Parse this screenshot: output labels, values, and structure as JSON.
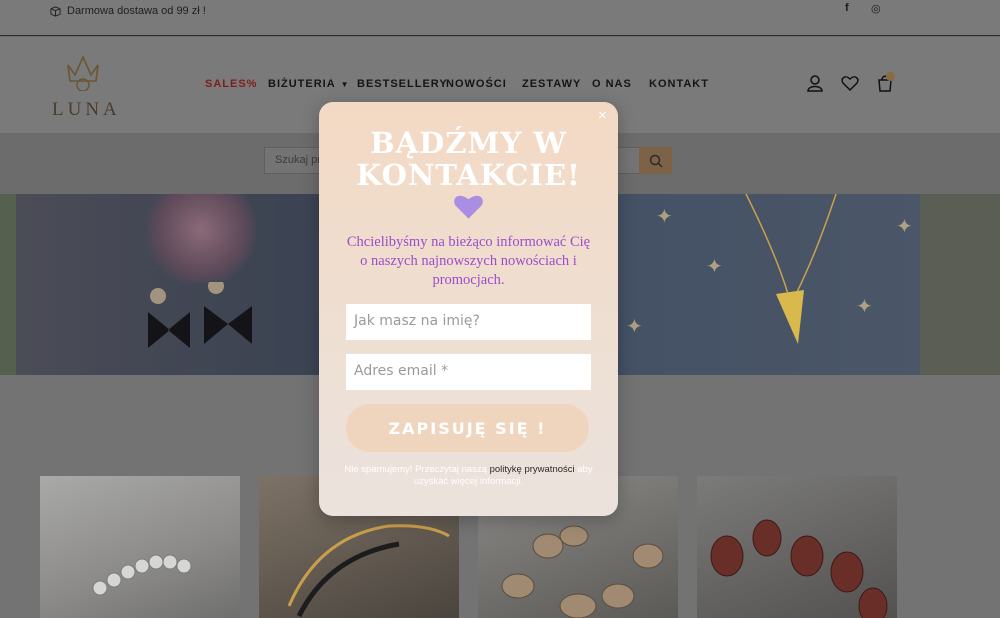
{
  "topbar": {
    "shipping_text": "Darmowa dostawa od 99 zł !",
    "facebook_glyph": "f",
    "instagram_glyph": "◎"
  },
  "header": {
    "logo_text": "LUNA",
    "nav": [
      {
        "label": "SALES%"
      },
      {
        "label": "BIŻUTERIA"
      },
      {
        "label": "BESTSELLERY"
      },
      {
        "label": "NOWOŚCI"
      },
      {
        "label": "ZESTAWY"
      },
      {
        "label": "O NAS"
      },
      {
        "label": "KONTAKT"
      }
    ],
    "icons": [
      "user-icon",
      "heart-icon",
      "cart-icon"
    ]
  },
  "search": {
    "placeholder": "Szukaj pr"
  },
  "popup": {
    "close_glyph": "×",
    "title": "BĄDŹMY W KONTAKCIE!",
    "message": "Chcielibyśmy na bieżąco informować Cię o naszych najnowszych nowościach i promocjach.",
    "name_placeholder": "Jak masz na imię?",
    "email_placeholder": "Adres email *",
    "button_label": "ZAPISUJĘ SIĘ !",
    "disclaimer_before": "Nie spamujemy! Przeczytaj naszą ",
    "disclaimer_link": "politykę prywatności",
    "disclaimer_after": " aby uzyskać więcej informacji.",
    "colors": {
      "heart": "#a98ee3",
      "message_text": "#9b4dcc",
      "button_bg": "#efd5bd"
    }
  }
}
